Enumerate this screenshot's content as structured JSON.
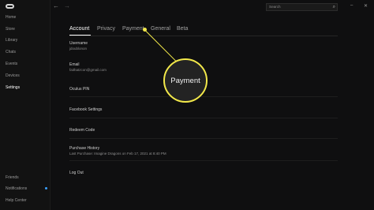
{
  "sidebar": {
    "items": [
      {
        "label": "Home"
      },
      {
        "label": "Store"
      },
      {
        "label": "Library"
      },
      {
        "label": "Chats"
      },
      {
        "label": "Events"
      },
      {
        "label": "Devices"
      },
      {
        "label": "Settings"
      }
    ],
    "bottom_items": [
      {
        "label": "Friends"
      },
      {
        "label": "Notifications"
      },
      {
        "label": "Help Center"
      }
    ]
  },
  "header": {
    "back_glyph": "←",
    "forward_glyph": "→",
    "search_placeholder": "Search",
    "search_icon": "⌕",
    "minimize_glyph": "–",
    "close_glyph": "✕"
  },
  "tabs": [
    {
      "label": "Account"
    },
    {
      "label": "Privacy"
    },
    {
      "label": "Payment"
    },
    {
      "label": "General"
    },
    {
      "label": "Beta"
    }
  ],
  "account": {
    "username_label": "Username",
    "username_value": "jdoublonon",
    "email_label": "Email",
    "email_value": "faithatzcon@gmail.com",
    "oculus_pin_label": "Oculus PIN",
    "facebook_settings_label": "Facebook Settings",
    "redeem_code_label": "Redeem Code",
    "purchase_history_label": "Purchase History",
    "purchase_history_value": "Last Purchase: Imagine Dragons on Feb 17, 2021 at 8:40 PM",
    "logout_label": "Log Out"
  },
  "callout": {
    "label": "Payment",
    "color": "#f2e84a"
  },
  "colors": {
    "background": "#0f0f10",
    "sidebar": "#121212",
    "notification_dot": "#3aa0ff"
  }
}
